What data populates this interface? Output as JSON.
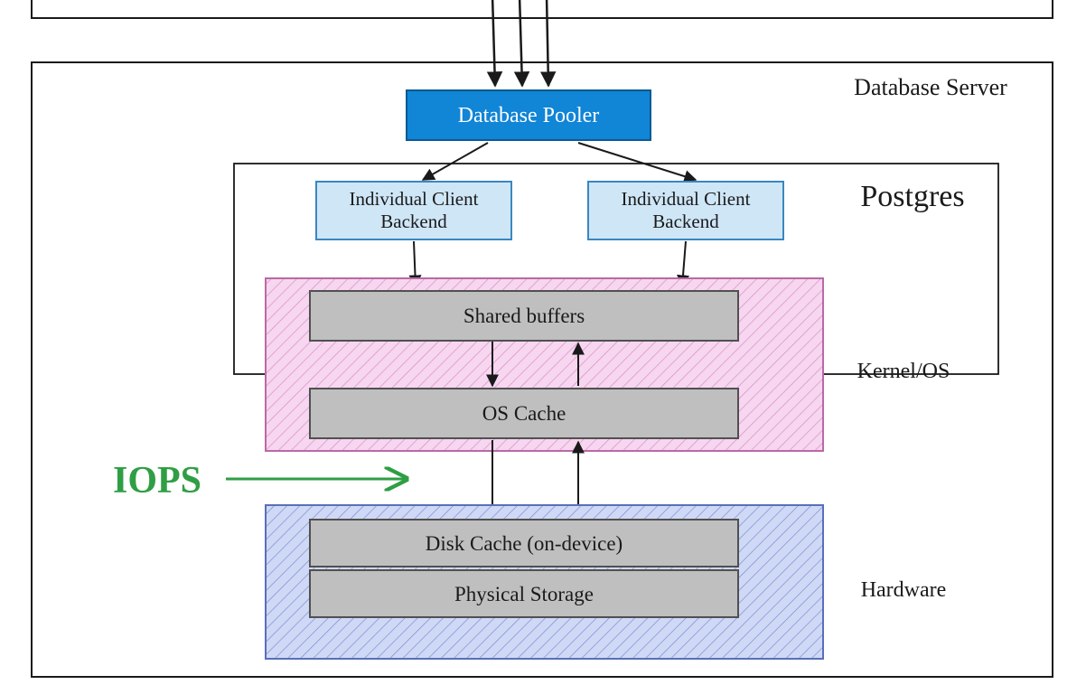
{
  "labels": {
    "database_server": "Database Server",
    "database_pooler": "Database Pooler",
    "postgres": "Postgres",
    "client_backend_1_line1": "Individual Client",
    "client_backend_1_line2": "Backend",
    "client_backend_2_line1": "Individual Client",
    "client_backend_2_line2": "Backend",
    "shared_buffers": "Shared buffers",
    "kernel_os": "Kernel/OS",
    "os_cache": "OS Cache",
    "iops": "IOPS",
    "disk_cache": "Disk Cache (on-device)",
    "physical_storage": "Physical Storage",
    "hardware": "Hardware"
  },
  "colors": {
    "pooler_fill": "#1185d6",
    "pooler_text": "#ffffff",
    "client_fill": "#cfe6f7",
    "gray_fill": "#bfbfbf",
    "pink_fill": "#f7d6f0",
    "blue_fill": "#cfd9f5",
    "iops_green": "#2f9e44",
    "stroke": "#1a1a1a"
  }
}
